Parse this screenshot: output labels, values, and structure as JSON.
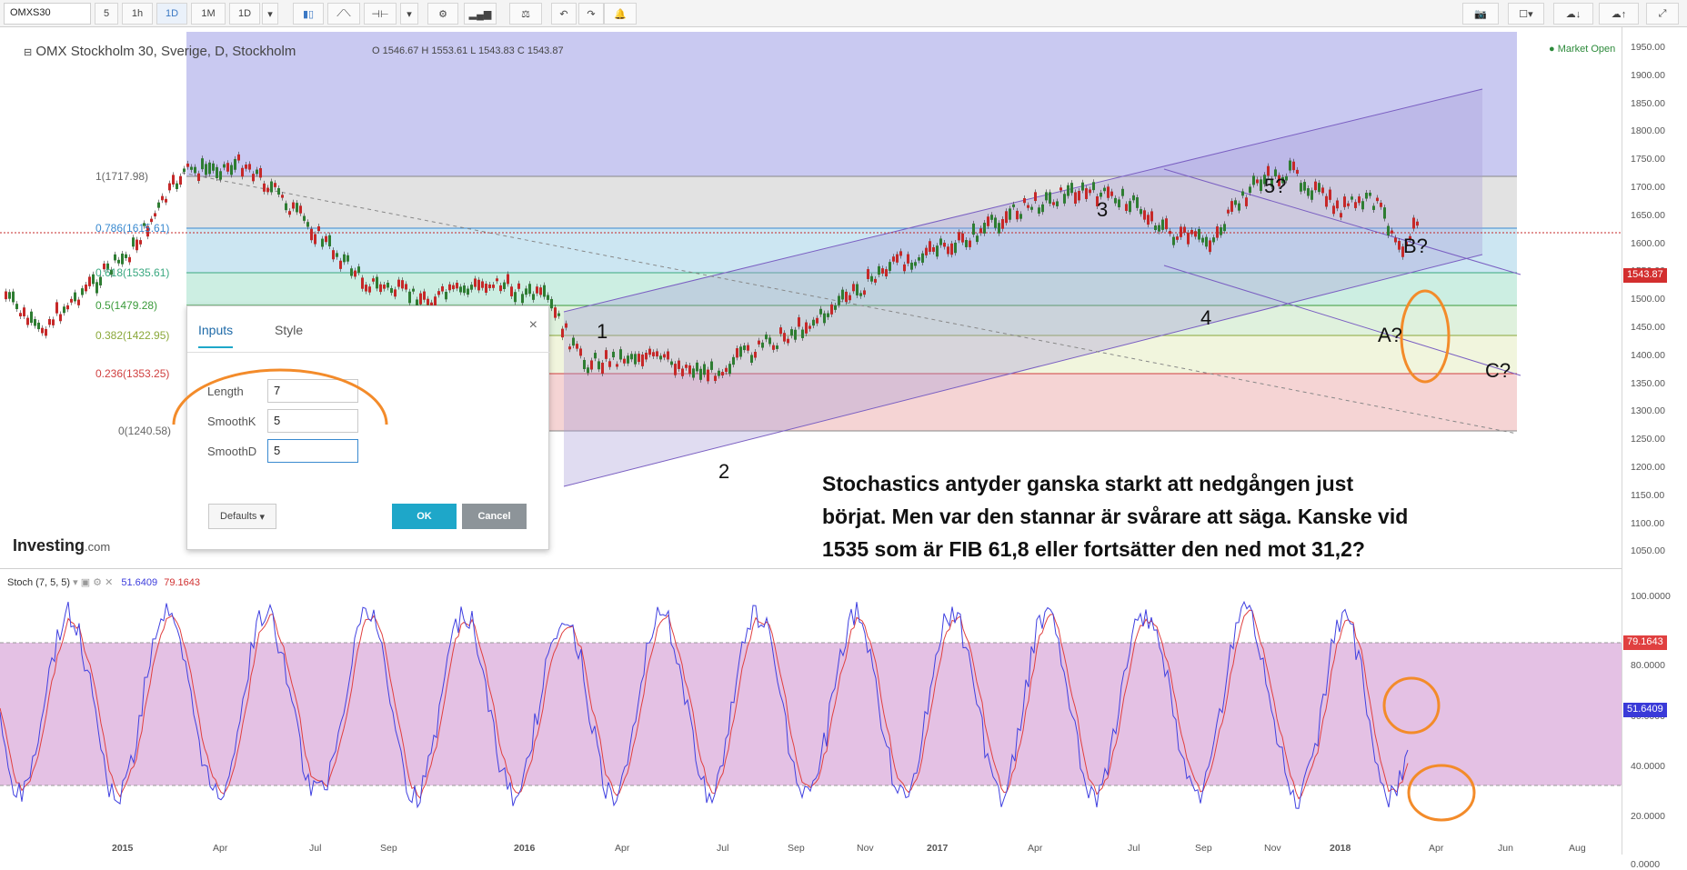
{
  "toolbar": {
    "symbol": "OMXS30",
    "intervals": [
      "5",
      "1h",
      "1D",
      "1M",
      "1D"
    ],
    "active_interval_index": 2,
    "icons": [
      "candle-icon",
      "line-chart-icon",
      "drawing-tools-icon",
      "settings-icon",
      "indicators-icon",
      "compare-icon",
      "undo-icon",
      "redo-icon",
      "alert-icon",
      "camera-icon",
      "template-icon",
      "cloud-download-icon",
      "cloud-upload-icon"
    ]
  },
  "chart": {
    "title": "OMX Stockholm 30, Sverige, D, Stockholm",
    "ohlc": "O 1546.67 H 1553.61 L 1543.83 C 1543.87",
    "market_status": "Market Open",
    "last_price": "1543.87",
    "y_ticks": [
      "1950.00",
      "1900.00",
      "1850.00",
      "1800.00",
      "1750.00",
      "1700.00",
      "1650.00",
      "1600.00",
      "1550.00",
      "1500.00",
      "1450.00",
      "1400.00",
      "1350.00",
      "1300.00",
      "1250.00",
      "1200.00",
      "1150.00",
      "1100.00",
      "1050.00"
    ],
    "x_ticks": [
      "2015",
      "Apr",
      "Jul",
      "Sep",
      "2016",
      "Apr",
      "Jul",
      "Sep",
      "Nov",
      "2017",
      "Apr",
      "Jul",
      "Sep",
      "Nov",
      "2018",
      "Apr",
      "Jun",
      "Aug"
    ],
    "fib_levels": [
      "1(1717.98)",
      "0.786(1615.61)",
      "0.618(1535.61)",
      "0.5(1479.28)",
      "0.382(1422.95)",
      "0.236(1353.25)",
      "0(1240.58)"
    ],
    "wave_labels": [
      "1",
      "2",
      "3",
      "4",
      "5?",
      "B?",
      "A?",
      "C?"
    ],
    "brand": "Investing",
    "brand_suffix": ".com",
    "annotation": "Stochastics antyder ganska starkt att nedgången just börjat. Men var den stannar är svårare att säga. Kanske vid 1535 som är FIB 61,8 eller fortsätter den ned mot 31,2?"
  },
  "stoch": {
    "title": "Stoch (7, 5, 5)",
    "k_value": "51.6409",
    "d_value": "79.1643",
    "y_ticks": [
      "100.0000",
      "80.0000",
      "60.0000",
      "40.0000",
      "20.0000",
      "0.0000"
    ]
  },
  "dialog": {
    "tabs": [
      "Inputs",
      "Style"
    ],
    "fields": [
      {
        "label": "Length",
        "value": "7"
      },
      {
        "label": "SmoothK",
        "value": "5"
      },
      {
        "label": "SmoothD",
        "value": "5"
      }
    ],
    "defaults_label": "Defaults",
    "ok_label": "OK",
    "cancel_label": "Cancel"
  },
  "colors": {
    "bull": "#2e7d32",
    "bear": "#c62828",
    "fib_top": "#9f9fe0",
    "stoch_band": "#d9a7d9",
    "k_line": "#4040e0",
    "d_line": "#e04040",
    "highlight": "#f38b2a",
    "ok_button": "#1ea7c9"
  }
}
